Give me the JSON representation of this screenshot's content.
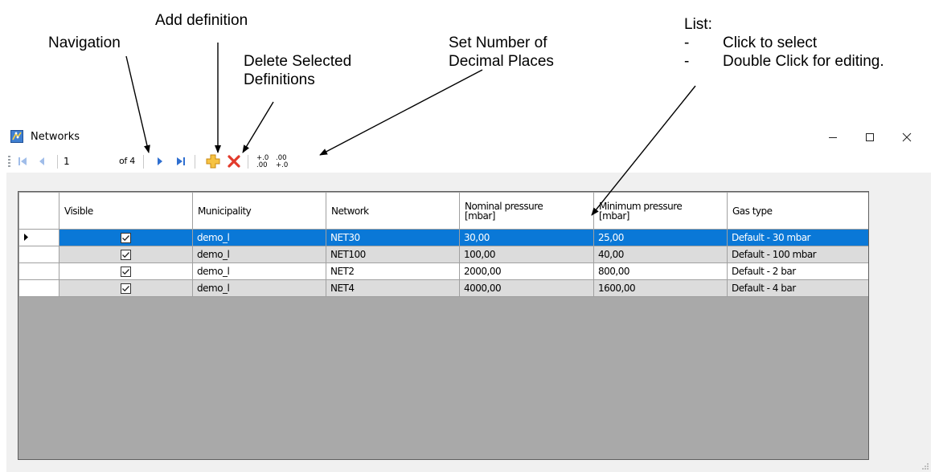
{
  "annotations": {
    "navigation": "Navigation",
    "add_definition": "Add definition",
    "delete_line1": "Delete Selected",
    "delete_line2": "Definitions",
    "decimal_line1": "Set Number of",
    "decimal_line2": "Decimal Places",
    "list_title": "List:",
    "list_items": [
      {
        "dash": "-",
        "text": "Click to select"
      },
      {
        "dash": "-",
        "text": "Double Click for editing."
      }
    ]
  },
  "window": {
    "title": "Networks",
    "app_icon": "networks-app-icon",
    "controls": {
      "minimize": "minimize-icon",
      "maximize": "maximize-icon",
      "close": "close-icon"
    }
  },
  "toolbar": {
    "position_value": "1",
    "of_label": "of 4",
    "icons": [
      "move-first-icon",
      "move-previous-icon",
      "move-next-icon",
      "move-last-icon",
      "add-icon",
      "delete-icon",
      "increase-decimals-icon",
      "decrease-decimals-icon"
    ],
    "increase_decimals_top": "+.0",
    "increase_decimals_bottom": ".00",
    "decrease_decimals_top": ".00",
    "decrease_decimals_bottom": "+.0"
  },
  "grid": {
    "columns": [
      {
        "line1": "Visible",
        "line2": ""
      },
      {
        "line1": "Municipality",
        "line2": ""
      },
      {
        "line1": "Network",
        "line2": ""
      },
      {
        "line1": "Nominal pressure",
        "line2": "[mbar]"
      },
      {
        "line1": "Minimum pressure",
        "line2": "[mbar]"
      },
      {
        "line1": "Gas type",
        "line2": ""
      }
    ],
    "rows": [
      {
        "visible": true,
        "municipality": "demo_l",
        "network": "NET30",
        "nominal": "30,00",
        "minimum": "25,00",
        "gas_type": "Default - 30 mbar"
      },
      {
        "visible": true,
        "municipality": "demo_l",
        "network": "NET100",
        "nominal": "100,00",
        "minimum": "40,00",
        "gas_type": "Default - 100 mbar"
      },
      {
        "visible": true,
        "municipality": "demo_l",
        "network": "NET2",
        "nominal": "2000,00",
        "minimum": "800,00",
        "gas_type": "Default - 2 bar"
      },
      {
        "visible": true,
        "municipality": "demo_l",
        "network": "NET4",
        "nominal": "4000,00",
        "minimum": "1600,00",
        "gas_type": "Default - 4 bar"
      }
    ],
    "selected_row": 0,
    "colors": {
      "selection": "#0a78d7",
      "alt_row": "#dcdcdc",
      "empty_area": "#a9a9a9"
    }
  }
}
